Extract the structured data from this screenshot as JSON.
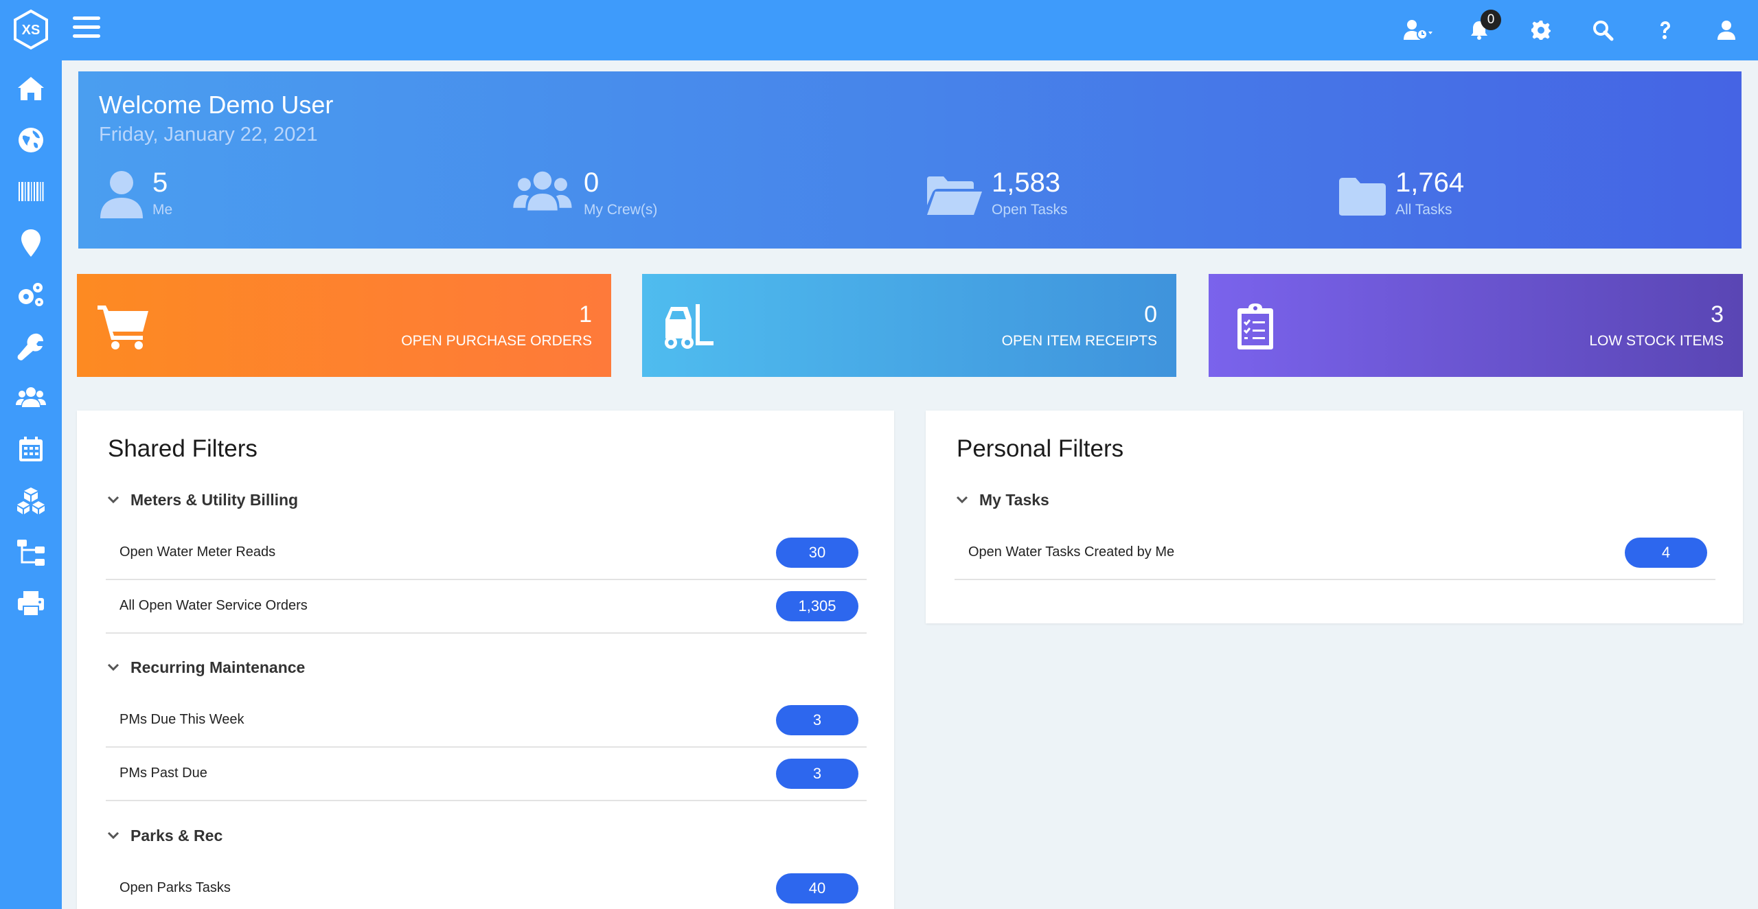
{
  "header": {
    "logo_text": "XS",
    "bell_count": "0"
  },
  "welcome": {
    "title": "Welcome Demo User",
    "date": "Friday, January 22, 2021",
    "stats": [
      {
        "value": "5",
        "label": "Me",
        "icon": "user-icon"
      },
      {
        "value": "0",
        "label": "My Crew(s)",
        "icon": "users-icon"
      },
      {
        "value": "1,583",
        "label": "Open Tasks",
        "icon": "folder-open-icon"
      },
      {
        "value": "1,764",
        "label": "All Tasks",
        "icon": "folder-icon"
      }
    ]
  },
  "kpis": [
    {
      "value": "1",
      "label": "OPEN PURCHASE ORDERS",
      "icon": "cart-icon",
      "color": "#fd8a22"
    },
    {
      "value": "0",
      "label": "OPEN ITEM RECEIPTS",
      "icon": "forklift-icon",
      "color": "#4fbcef"
    },
    {
      "value": "3",
      "label": "LOW STOCK ITEMS",
      "icon": "clipboard-list-icon",
      "color": "#6a55d8"
    }
  ],
  "shared_filters": {
    "title": "Shared Filters",
    "groups": [
      {
        "name": "Meters & Utility Billing",
        "rows": [
          {
            "label": "Open Water Meter Reads",
            "count": "30"
          },
          {
            "label": "All Open Water Service Orders",
            "count": "1,305"
          }
        ]
      },
      {
        "name": "Recurring Maintenance",
        "rows": [
          {
            "label": "PMs Due This Week",
            "count": "3"
          },
          {
            "label": "PMs Past Due",
            "count": "3"
          }
        ]
      },
      {
        "name": "Parks & Rec",
        "rows": [
          {
            "label": "Open Parks Tasks",
            "count": "40"
          }
        ]
      }
    ]
  },
  "personal_filters": {
    "title": "Personal Filters",
    "groups": [
      {
        "name": "My Tasks",
        "rows": [
          {
            "label": "Open Water Tasks Created by Me",
            "count": "4"
          }
        ]
      }
    ]
  },
  "colors": {
    "primary": "#3e9bfb",
    "badge": "#2d67ee",
    "background": "#edf3f7"
  }
}
